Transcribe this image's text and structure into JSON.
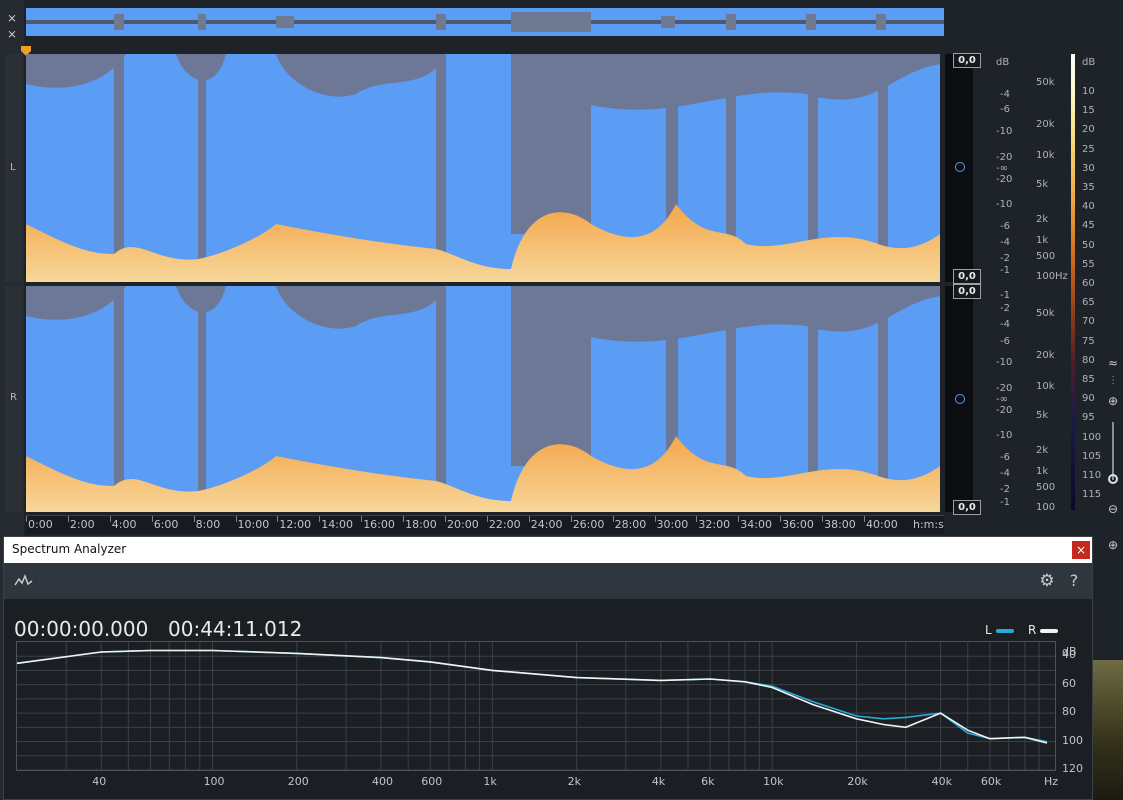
{
  "editor": {
    "channels": {
      "left": "L",
      "right": "R"
    },
    "level_boxes": [
      "0,0",
      "0,0",
      "0,0",
      "0,0"
    ],
    "db_scale_top": [
      "dB",
      "-4",
      "-6",
      "-10",
      "-20",
      "-∞",
      "-20",
      "-10",
      "-6",
      "-4",
      "-2",
      "-1"
    ],
    "db_scale_bottom": [
      "-1",
      "-2",
      "-4",
      "-6",
      "-10",
      "-20",
      "-∞",
      "-20",
      "-10",
      "-6",
      "-4",
      "-2",
      "-1"
    ],
    "freq_scale_top": [
      "50k",
      "20k",
      "10k",
      "5k",
      "2k",
      "1k",
      "500",
      "100"
    ],
    "freq_scale_bottom": [
      "50k",
      "20k",
      "10k",
      "5k",
      "2k",
      "1k",
      "500",
      "100"
    ],
    "freq_unit": "Hz",
    "colorbar_unit": "dB",
    "colorbar_ticks": [
      "10",
      "15",
      "20",
      "25",
      "30",
      "35",
      "40",
      "45",
      "50",
      "55",
      "60",
      "65",
      "70",
      "75",
      "80",
      "85",
      "90",
      "95",
      "100",
      "105",
      "110",
      "115"
    ],
    "timeline": [
      "0:00",
      "2:00",
      "4:00",
      "6:00",
      "8:00",
      "10:00",
      "12:00",
      "14:00",
      "16:00",
      "18:00",
      "20:00",
      "22:00",
      "24:00",
      "26:00",
      "28:00",
      "30:00",
      "32:00",
      "34:00",
      "36:00",
      "38:00",
      "40:00",
      "h:m:s"
    ],
    "icon_colors": {
      "playhead": "#f0a020"
    }
  },
  "analyzer": {
    "title": "Spectrum Analyzer",
    "start_time": "00:00:00.000",
    "end_time": "00:44:11.012",
    "legend": [
      {
        "label": "L",
        "color": "#2aa9d6"
      },
      {
        "label": "R",
        "color": "#f2f2f2"
      }
    ],
    "x_ticks": [
      "40",
      "100",
      "200",
      "400",
      "600",
      "1k",
      "2k",
      "4k",
      "6k",
      "10k",
      "20k",
      "40k",
      "60k",
      "Hz"
    ],
    "y_unit": "dB",
    "y_ticks": [
      "40",
      "60",
      "80",
      "100",
      "120"
    ]
  },
  "chart_data": {
    "type": "line",
    "x": [
      20,
      40,
      60,
      100,
      200,
      400,
      600,
      1000,
      2000,
      4000,
      6000,
      8000,
      10000,
      14000,
      20000,
      25000,
      30000,
      40000,
      50000,
      60000,
      80000,
      96000
    ],
    "series": [
      {
        "name": "L",
        "values": [
          -45,
          -37,
          -36,
          -36,
          -38,
          -41,
          -44,
          -50,
          -55,
          -57,
          -56,
          -58,
          -61,
          -72,
          -82,
          -84,
          -83,
          -80,
          -94,
          -98,
          -97,
          -100
        ]
      },
      {
        "name": "R",
        "values": [
          -45,
          -37,
          -36,
          -36,
          -38,
          -41,
          -44,
          -50,
          -55,
          -57,
          -56,
          -58,
          -62,
          -74,
          -84,
          -88,
          -90,
          -80,
          -92,
          -98,
          -97,
          -101
        ]
      }
    ],
    "xlabel": "Hz",
    "ylabel": "dB",
    "x_scale": "log",
    "ylim": [
      -120,
      -30
    ],
    "grid": true
  }
}
